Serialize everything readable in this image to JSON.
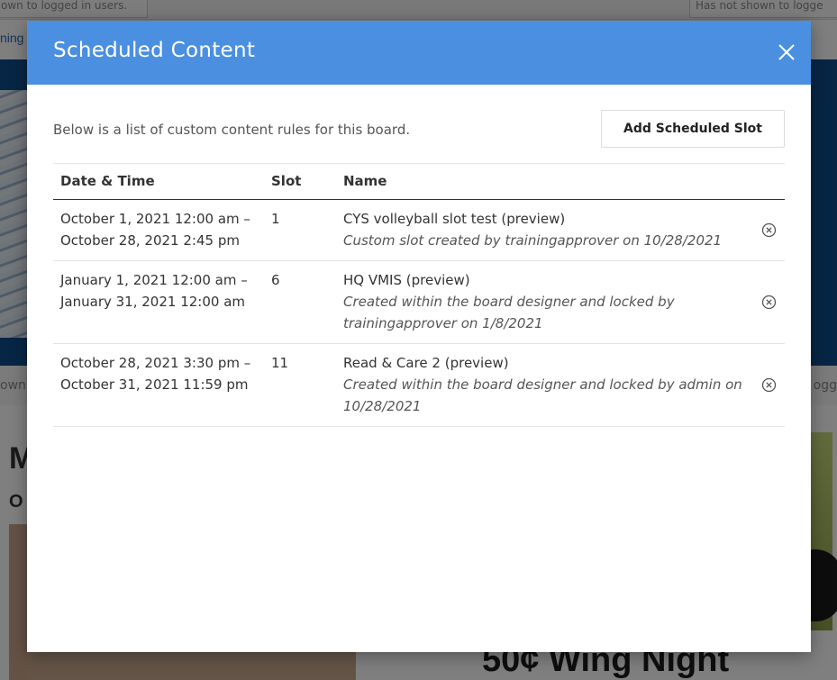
{
  "background": {
    "top_left_box": "own to logged in users.",
    "top_right_box": "Has not shown to logge",
    "link_text": "ning",
    "strip_left": "own t",
    "strip_right": "ogg",
    "heading_partial": "M",
    "subheading_partial": "O",
    "promo_title": "50¢ Wing Night"
  },
  "modal": {
    "title": "Scheduled Content",
    "intro": "Below is a list of custom content rules for this board.",
    "add_button_label": "Add Scheduled Slot",
    "columns": [
      "Date & Time",
      "Slot",
      "Name"
    ],
    "rows": [
      {
        "date_start": "October 1, 2021 12:00 am –",
        "date_end": "October 28, 2021 2:45 pm",
        "slot": "1",
        "name": "CYS volleyball slot test (preview)",
        "description": "Custom slot created by trainingapprover on 10/28/2021"
      },
      {
        "date_start": "January 1, 2021 12:00 am –",
        "date_end": "January 31, 2021 12:00 am",
        "slot": "6",
        "name": "HQ VMIS (preview)",
        "description": "Created within the board designer and locked by trainingapprover on 1/8/2021"
      },
      {
        "date_start": "October 28, 2021 3:30 pm –",
        "date_end": "October 31, 2021 11:59 pm",
        "slot": "11",
        "name": "Read & Care 2 (preview)",
        "description": "Created within the board designer and locked by admin on 10/28/2021"
      }
    ]
  },
  "colors": {
    "header_bg": "#4a8fe0",
    "banner_bg": "#0f4c8a"
  },
  "icons": {
    "close": "close-icon",
    "remove": "remove-circle-x-icon"
  }
}
